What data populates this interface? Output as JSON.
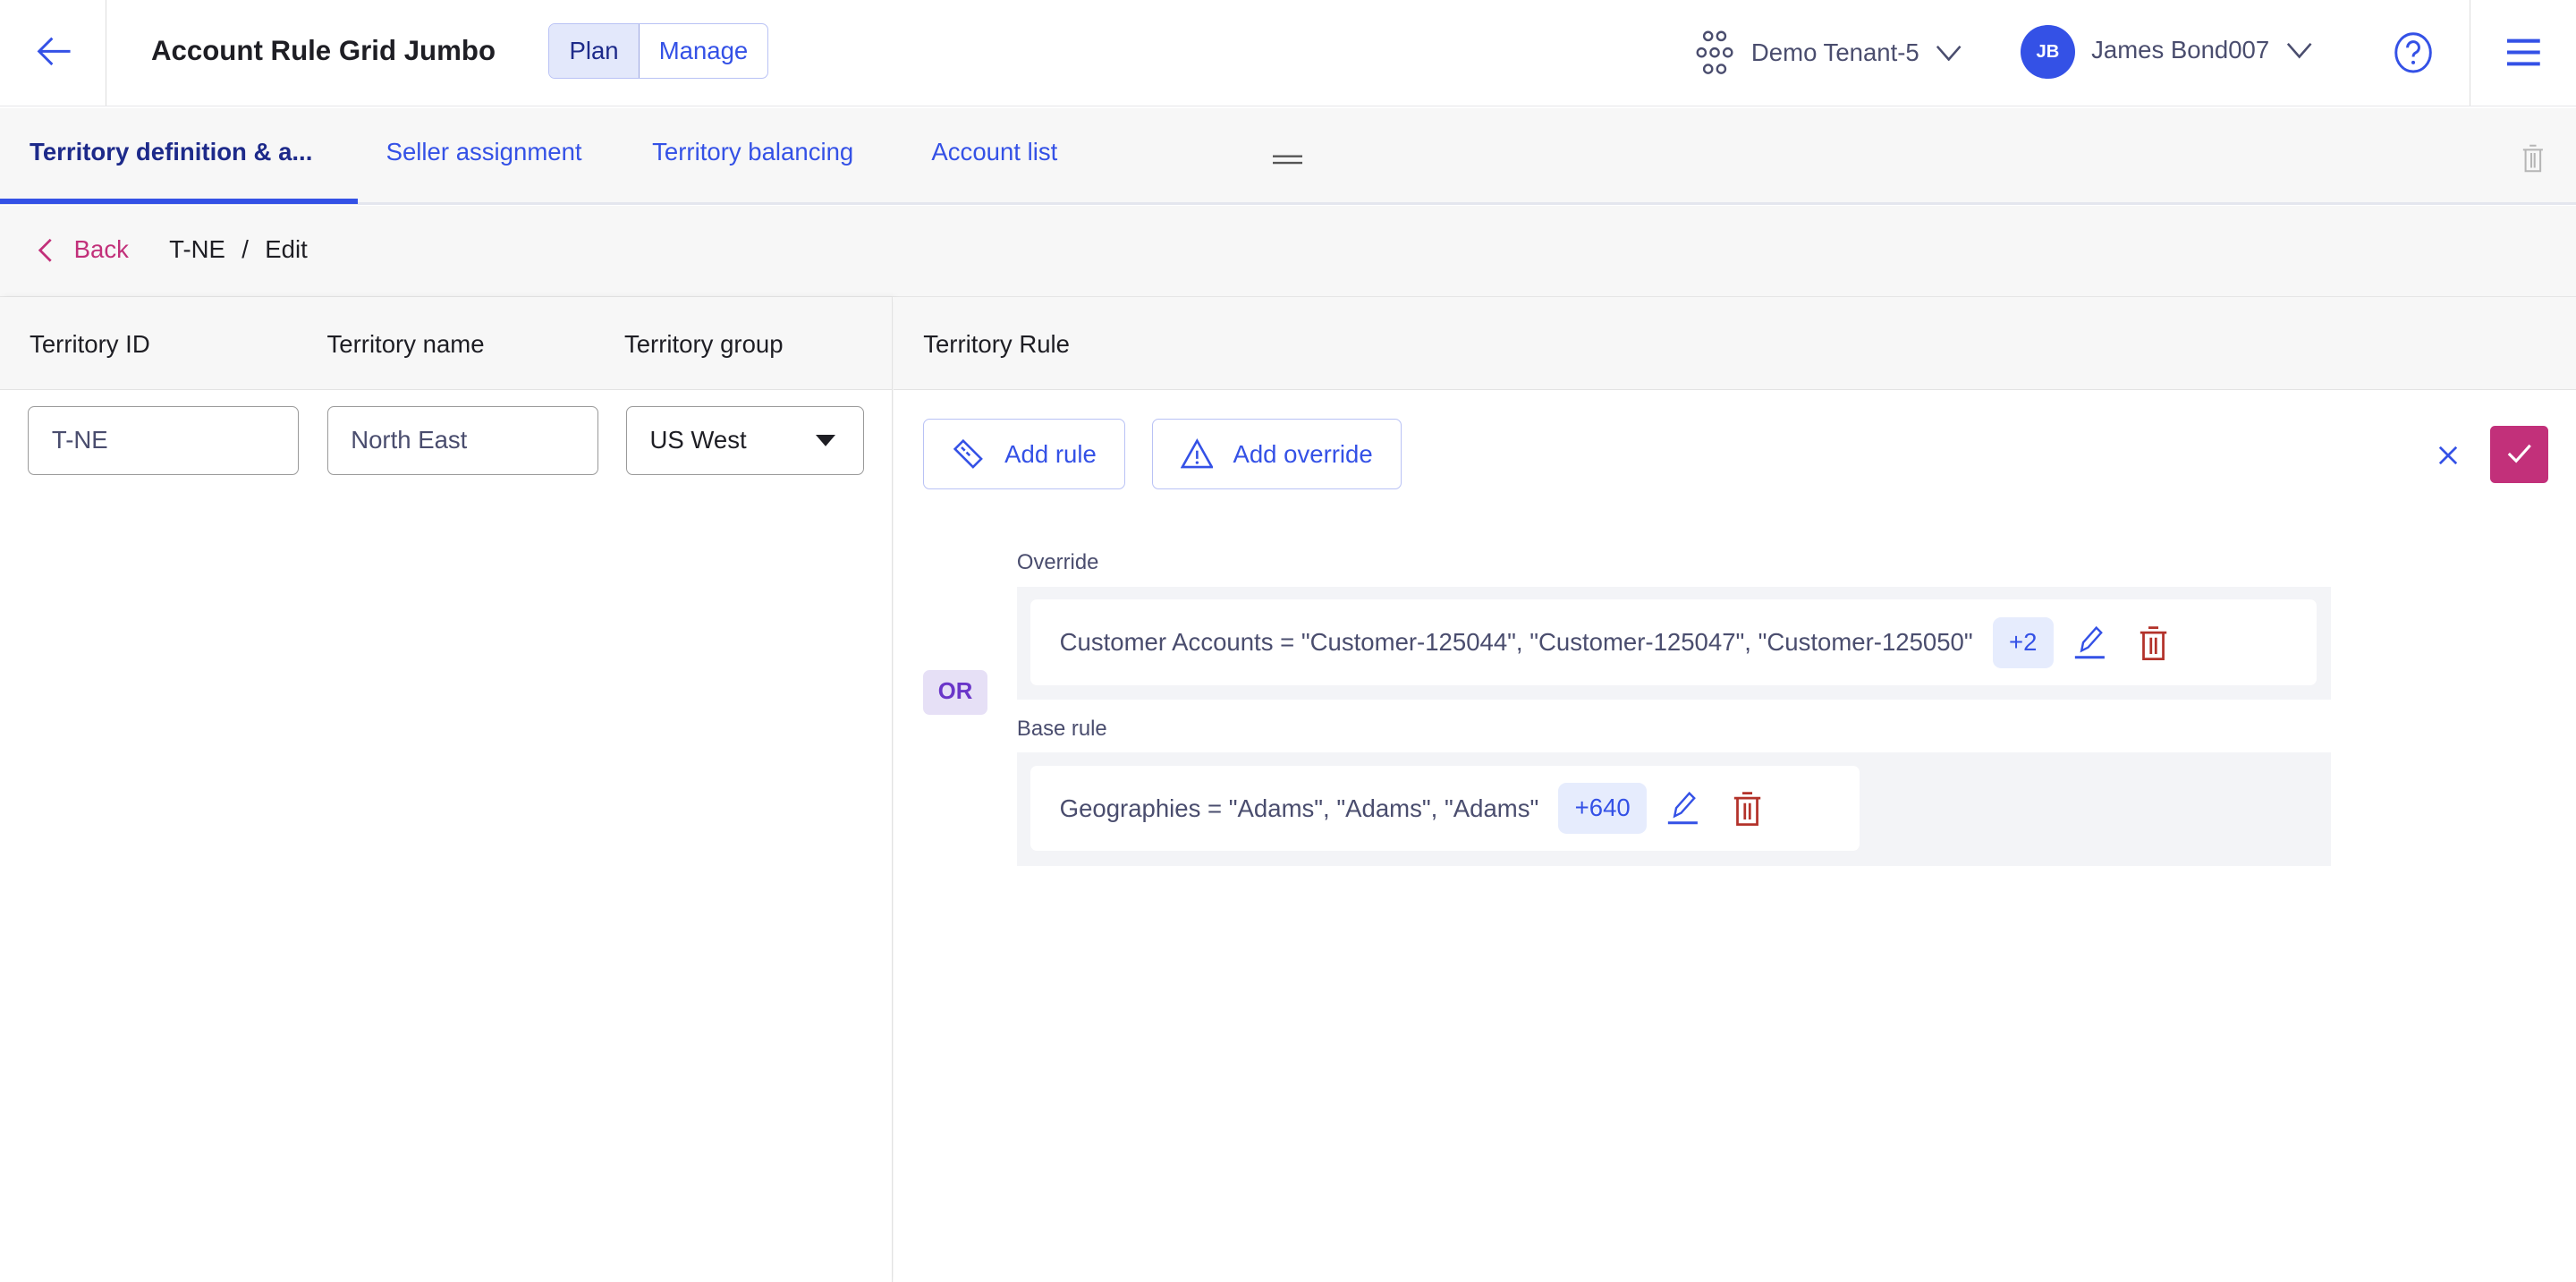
{
  "header": {
    "title": "Account Rule Grid Jumbo",
    "mode_plan": "Plan",
    "mode_manage": "Manage",
    "tenant": "Demo Tenant-5",
    "user_initials": "JB",
    "user_name": "James Bond007"
  },
  "tabs": [
    {
      "label": "Territory definition & a...",
      "active": true
    },
    {
      "label": "Seller assignment"
    },
    {
      "label": "Territory balancing"
    },
    {
      "label": "Account list"
    }
  ],
  "breadcrumb": {
    "back": "Back",
    "territory": "T-NE",
    "separator": "/",
    "page": "Edit"
  },
  "form": {
    "columns": [
      "Territory ID",
      "Territory name",
      "Territory group"
    ],
    "territory_id": "T-NE",
    "territory_name": "North East",
    "territory_group": "US West"
  },
  "rule_panel": {
    "title": "Territory Rule",
    "add_rule": "Add rule",
    "add_override": "Add override",
    "operator": "OR",
    "override": {
      "label": "Override",
      "text": "Customer Accounts  =  \"Customer-125044\", \"Customer-125047\", \"Customer-125050\"",
      "more": "+2"
    },
    "base": {
      "label": "Base rule",
      "text": "Geographies  =  \"Adams\", \"Adams\", \"Adams\"",
      "more": "+640"
    }
  },
  "colors": {
    "accent": "#3451e6",
    "confirm": "#c2307a",
    "delete": "#b3322a",
    "or_badge": "#6a36c9"
  }
}
